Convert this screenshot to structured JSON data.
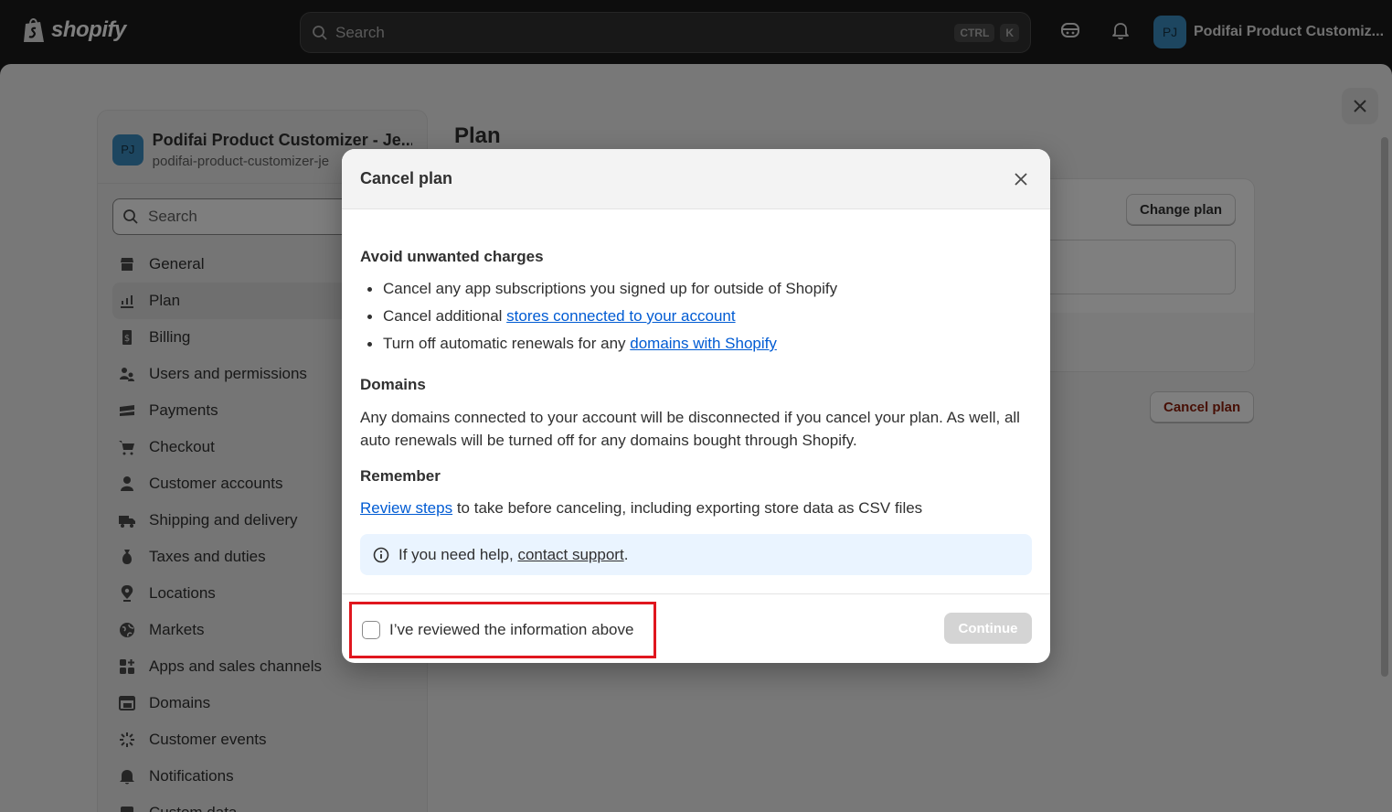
{
  "topbar": {
    "brand": "shopify",
    "search_placeholder": "Search",
    "shortcut_ctrl": "CTRL",
    "shortcut_k": "K",
    "avatar_initials": "PJ",
    "store_name": "Podifai Product Customiz..."
  },
  "sidebar": {
    "store_title": "Podifai Product Customizer - Je...",
    "store_subtitle": "podifai-product-customizer-je",
    "search_placeholder": "Search",
    "items": [
      {
        "label": "General",
        "icon": "store-icon"
      },
      {
        "label": "Plan",
        "icon": "plan-icon"
      },
      {
        "label": "Billing",
        "icon": "billing-icon"
      },
      {
        "label": "Users and permissions",
        "icon": "users-icon"
      },
      {
        "label": "Payments",
        "icon": "payments-icon"
      },
      {
        "label": "Checkout",
        "icon": "cart-icon"
      },
      {
        "label": "Customer accounts",
        "icon": "person-icon"
      },
      {
        "label": "Shipping and delivery",
        "icon": "truck-icon"
      },
      {
        "label": "Taxes and duties",
        "icon": "tax-icon"
      },
      {
        "label": "Locations",
        "icon": "location-icon"
      },
      {
        "label": "Markets",
        "icon": "globe-icon"
      },
      {
        "label": "Apps and sales channels",
        "icon": "apps-icon"
      },
      {
        "label": "Domains",
        "icon": "domains-icon"
      },
      {
        "label": "Customer events",
        "icon": "events-icon"
      },
      {
        "label": "Notifications",
        "icon": "bell-icon"
      },
      {
        "label": "Custom data",
        "icon": "data-icon"
      }
    ]
  },
  "main": {
    "title": "Plan",
    "change_plan": "Change plan",
    "cancel_plan": "Cancel plan"
  },
  "modal": {
    "title": "Cancel plan",
    "section1_heading": "Avoid unwanted charges",
    "bullet1": "Cancel any app subscriptions you signed up for outside of Shopify",
    "bullet2_prefix": "Cancel additional ",
    "bullet2_link": "stores connected to your account",
    "bullet3_prefix": "Turn off automatic renewals for any ",
    "bullet3_link": "domains with Shopify",
    "section2_heading": "Domains",
    "section2_text": "Any domains connected to your account will be disconnected if you cancel your plan. As well, all auto renewals will be turned off for any domains bought through Shopify.",
    "section3_heading": "Remember",
    "section3_link": "Review steps",
    "section3_suffix": " to take before canceling, including exporting store data as CSV files",
    "info_prefix": "If you need help, ",
    "info_link": "contact support",
    "info_suffix": ".",
    "checkbox_label": "I’ve reviewed the information above",
    "checkbox_checked": false,
    "continue_label": "Continue"
  },
  "colors": {
    "link": "#005bd3",
    "highlight_border": "#e0161e",
    "cancel_text": "#8e1f0b",
    "info_bg": "#eaf4ff"
  }
}
